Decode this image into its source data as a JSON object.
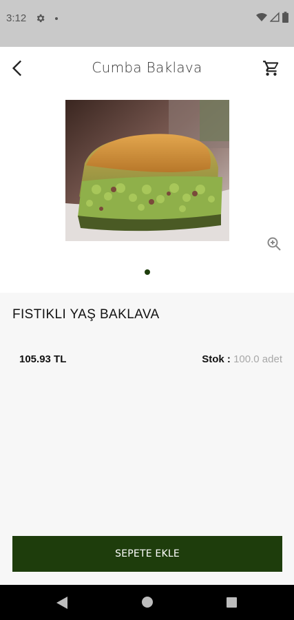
{
  "status_bar": {
    "time": "3:12",
    "icons": [
      "gear-icon",
      "notification-dot",
      "wifi-icon",
      "signal-icon",
      "battery-icon"
    ]
  },
  "app_bar": {
    "title": "Cumba Baklava",
    "back_icon": "chevron-left-icon",
    "cart_icon": "shopping-cart-icon"
  },
  "gallery": {
    "image": "pistachio-baklava-photo",
    "zoom_icon": "zoom-in-icon",
    "page_count": 1,
    "active_page": 1
  },
  "product": {
    "name": "FISTIKLI YAŞ BAKLAVA",
    "price": "105.93 TL",
    "stock_label": "Stok :",
    "stock_value": "100.0 adet"
  },
  "actions": {
    "add_to_cart_label": "SEPETE EKLE"
  },
  "colors": {
    "primary": "#1e3d0c",
    "status_bar": "#c9c9c9",
    "background": "#f7f7f7",
    "muted_text": "#a8a8a8"
  },
  "nav_bar": {
    "buttons": [
      "back-triangle-icon",
      "home-circle-icon",
      "recents-square-icon"
    ]
  }
}
